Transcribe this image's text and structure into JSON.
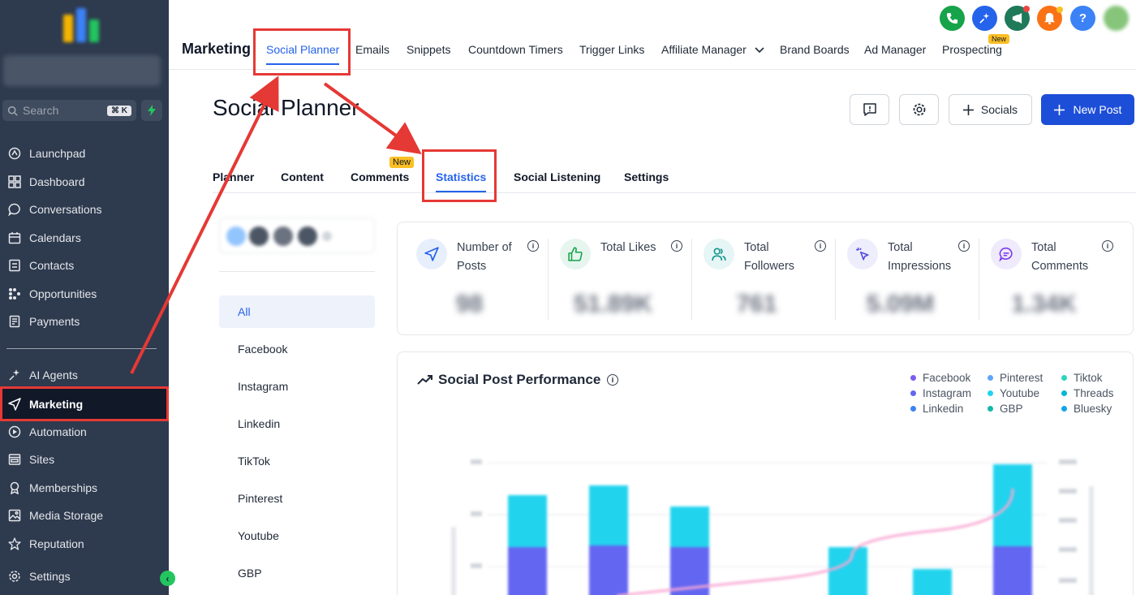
{
  "sidebar": {
    "search_placeholder": "Search",
    "search_shortcut": "⌘ K",
    "items": [
      {
        "label": "Launchpad",
        "icon": "launchpad-icon"
      },
      {
        "label": "Dashboard",
        "icon": "dashboard-icon"
      },
      {
        "label": "Conversations",
        "icon": "chat-icon"
      },
      {
        "label": "Calendars",
        "icon": "calendar-icon"
      },
      {
        "label": "Contacts",
        "icon": "contacts-icon"
      },
      {
        "label": "Opportunities",
        "icon": "opportunities-icon"
      },
      {
        "label": "Payments",
        "icon": "payments-icon"
      },
      {
        "label": "AI Agents",
        "icon": "sparkle-icon"
      },
      {
        "label": "Marketing",
        "icon": "send-icon"
      },
      {
        "label": "Automation",
        "icon": "automation-icon"
      },
      {
        "label": "Sites",
        "icon": "sites-icon"
      },
      {
        "label": "Memberships",
        "icon": "membership-icon"
      },
      {
        "label": "Media Storage",
        "icon": "image-icon"
      },
      {
        "label": "Reputation",
        "icon": "star-icon"
      },
      {
        "label": "Settings",
        "icon": "gear-icon"
      }
    ]
  },
  "topnav": {
    "brand": "Marketing",
    "tabs": [
      "Social Planner",
      "Emails",
      "Snippets",
      "Countdown Timers",
      "Trigger Links",
      "Affiliate Manager",
      "Brand Boards",
      "Ad Manager",
      "Prospecting"
    ],
    "new_badge": "New"
  },
  "header": {
    "title": "Social Planner",
    "socials_label": "Socials",
    "new_post_label": "New Post"
  },
  "subtabs": [
    "Planner",
    "Content",
    "Comments",
    "Statistics",
    "Social Listening",
    "Settings"
  ],
  "platforms": [
    "All",
    "Facebook",
    "Instagram",
    "Linkedin",
    "TikTok",
    "Pinterest",
    "Youtube",
    "GBP"
  ],
  "stats": [
    {
      "label": "Number of Posts",
      "value": "98"
    },
    {
      "label": "Total Likes",
      "value": "51.89K"
    },
    {
      "label": "Total Followers",
      "value": "761"
    },
    {
      "label": "Total Impressions",
      "value": "5.09M"
    },
    {
      "label": "Total Comments",
      "value": "1.34K"
    }
  ],
  "chart": {
    "title": "Social Post Performance",
    "legend": [
      {
        "name": "Facebook",
        "color": "#7c5cf0"
      },
      {
        "name": "Instagram",
        "color": "#6366f1"
      },
      {
        "name": "Linkedin",
        "color": "#3b82f6"
      },
      {
        "name": "Pinterest",
        "color": "#60a5fa"
      },
      {
        "name": "Youtube",
        "color": "#22d3ee"
      },
      {
        "name": "GBP",
        "color": "#14b8a6"
      },
      {
        "name": "Tiktok",
        "color": "#2dd4bf"
      },
      {
        "name": "Threads",
        "color": "#06b6d4"
      },
      {
        "name": "Bluesky",
        "color": "#0ea5e9"
      }
    ]
  },
  "colors": {
    "sidebar_bg": "#2e3a4e",
    "accent": "#2563eb",
    "annotation_red": "#e53935"
  }
}
